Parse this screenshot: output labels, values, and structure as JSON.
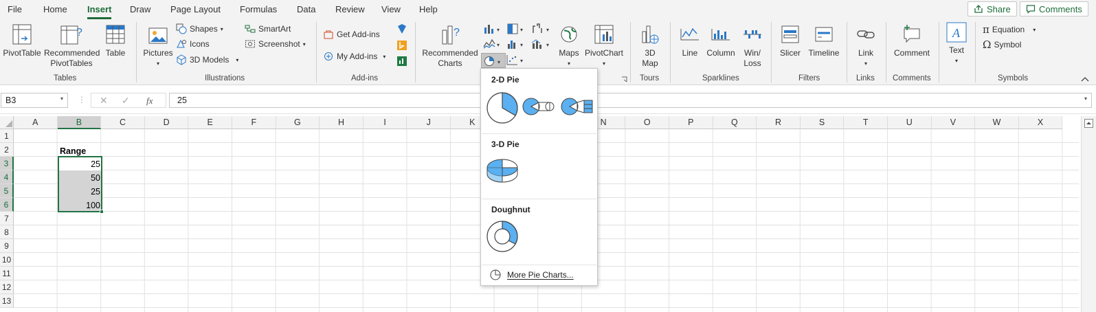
{
  "menu": {
    "tabs": [
      "File",
      "Home",
      "Insert",
      "Draw",
      "Page Layout",
      "Formulas",
      "Data",
      "Review",
      "View",
      "Help"
    ],
    "active_tab": "Insert",
    "share_label": "Share",
    "comments_label": "Comments"
  },
  "ribbon": {
    "tables": {
      "pivottable": "PivotTable",
      "rec_pivot_1": "Recommended",
      "rec_pivot_2": "PivotTables",
      "table": "Table",
      "group": "Tables"
    },
    "illustrations": {
      "pictures": "Pictures",
      "shapes": "Shapes",
      "icons": "Icons",
      "models": "3D Models",
      "smartart": "SmartArt",
      "screenshot": "Screenshot",
      "group": "Illustrations"
    },
    "addins": {
      "get": "Get Add-ins",
      "my": "My Add-ins",
      "group": "Add-ins"
    },
    "charts": {
      "rec_1": "Recommended",
      "rec_2": "Charts",
      "maps": "Maps",
      "pivotchart": "PivotChart"
    },
    "tours": {
      "map_1": "3D",
      "map_2": "Map",
      "group": "Tours"
    },
    "sparklines": {
      "line": "Line",
      "column": "Column",
      "winloss_1": "Win/",
      "winloss_2": "Loss",
      "group": "Sparklines"
    },
    "filters": {
      "slicer": "Slicer",
      "timeline": "Timeline",
      "group": "Filters"
    },
    "links": {
      "link": "Link",
      "group": "Links"
    },
    "comments": {
      "comment": "Comment",
      "group": "Comments"
    },
    "text": {
      "text": "Text"
    },
    "symbols": {
      "equation": "Equation",
      "symbol": "Symbol",
      "group": "Symbols"
    }
  },
  "formula_bar": {
    "name_box": "B3",
    "fx": "fx",
    "value": "25"
  },
  "sheet": {
    "columns": [
      "A",
      "B",
      "C",
      "D",
      "E",
      "F",
      "G",
      "H",
      "I",
      "J",
      "K",
      "L",
      "M",
      "N",
      "O",
      "P",
      "Q",
      "R",
      "S",
      "T",
      "U",
      "V",
      "W",
      "X"
    ],
    "rows": [
      "1",
      "2",
      "3",
      "4",
      "5",
      "6",
      "7",
      "8",
      "9",
      "10",
      "11",
      "12",
      "13"
    ],
    "header_cell": "Range",
    "values": [
      "25",
      "50",
      "25",
      "100"
    ]
  },
  "pie_dropdown": {
    "section_2d": "2-D Pie",
    "section_3d": "3-D Pie",
    "section_doughnut": "Doughnut",
    "more": "More Pie Charts..."
  },
  "colors": {
    "accent": "#1e6c3a",
    "pie_fill": "#5ab0f0",
    "selection": "#217346"
  }
}
